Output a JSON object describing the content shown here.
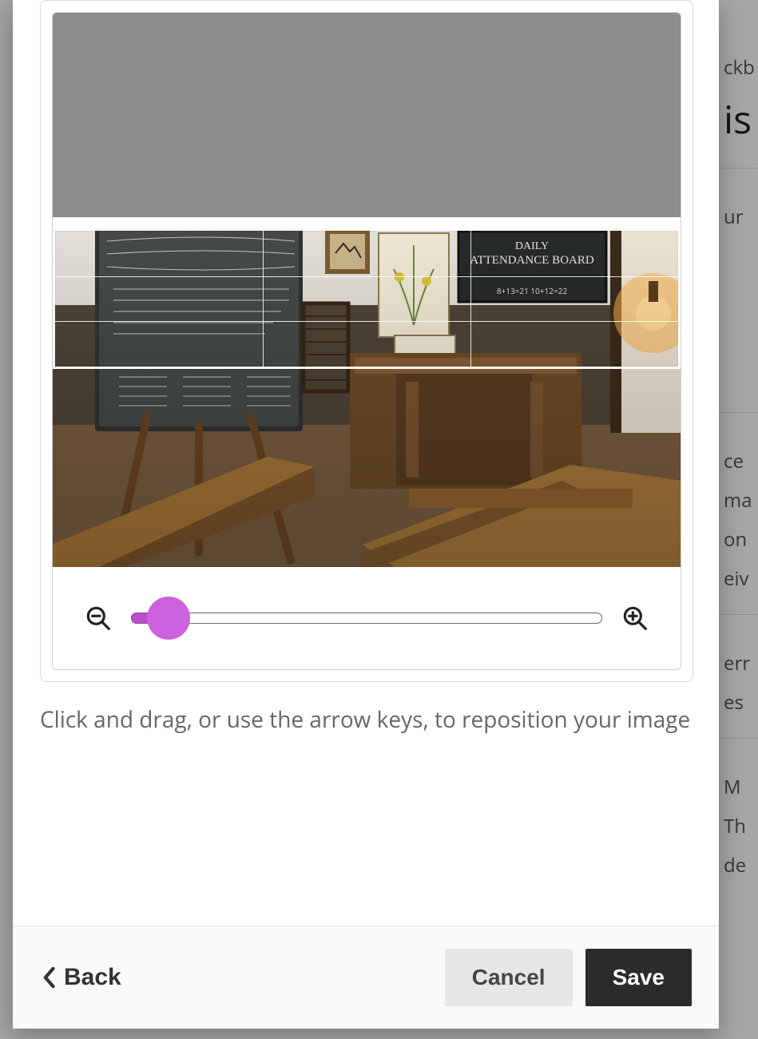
{
  "editor": {
    "help_text": "Click and drag, or use the arrow keys, to reposition your image",
    "zoom_value": 6
  },
  "footer": {
    "back_label": "Back",
    "cancel_label": "Cancel",
    "save_label": "Save"
  },
  "background_fragments": {
    "line1": "ckb",
    "line2": "is",
    "line3": "ur",
    "line4": "ce",
    "line5a": "ma",
    "line5b": "on",
    "line5c": "eiv",
    "line6": "err",
    "line7": "es",
    "line8": "M",
    "line9a": "Th",
    "line9b": "de"
  }
}
